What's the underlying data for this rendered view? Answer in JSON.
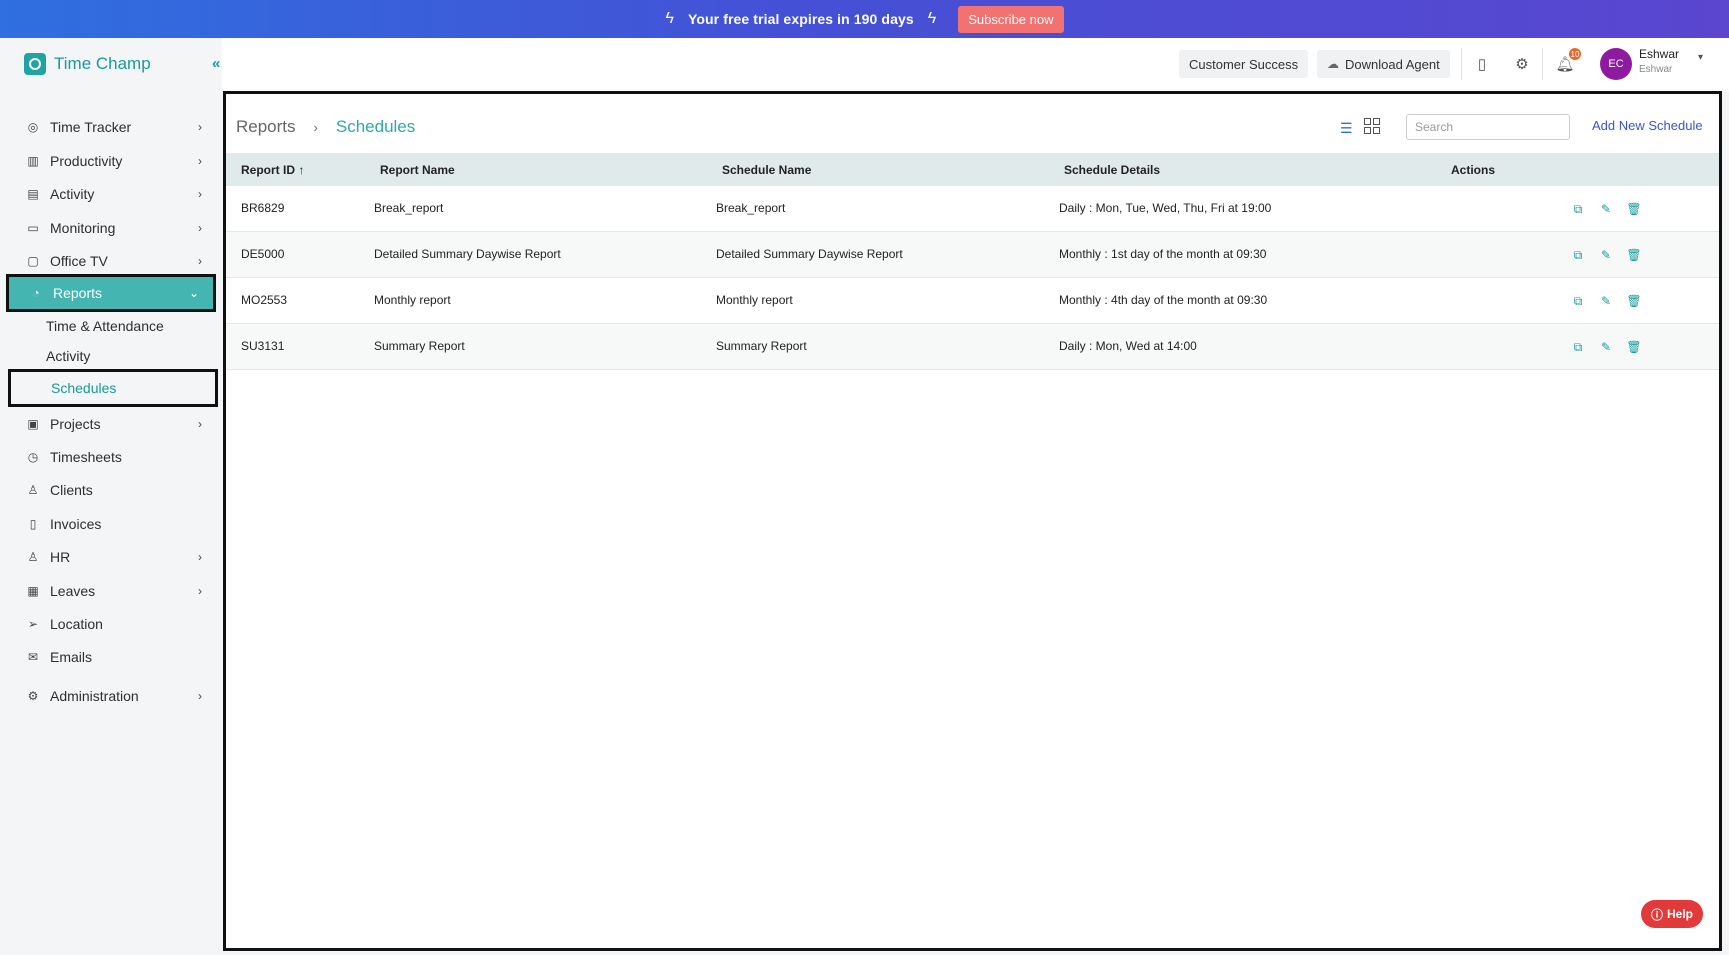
{
  "banner": {
    "text": "Your free trial expires in 190 days",
    "subscribe_label": "Subscribe now"
  },
  "brand": {
    "name": "Time Champ",
    "collapse_glyph": "«"
  },
  "sidebar": {
    "items": [
      {
        "label": "Time Tracker",
        "icon": "target-icon"
      },
      {
        "label": "Productivity",
        "icon": "bar-chart-icon"
      },
      {
        "label": "Activity",
        "icon": "activity-icon"
      },
      {
        "label": "Monitoring",
        "icon": "monitor-icon"
      },
      {
        "label": "Office TV",
        "icon": "tv-icon"
      },
      {
        "label": "Reports",
        "icon": "pie-chart-icon"
      },
      {
        "label": "Projects",
        "icon": "briefcase-icon"
      },
      {
        "label": "Timesheets",
        "icon": "alarm-clock-icon"
      },
      {
        "label": "Clients",
        "icon": "user-badge-icon"
      },
      {
        "label": "Invoices",
        "icon": "invoice-icon"
      },
      {
        "label": "HR",
        "icon": "person-icon"
      },
      {
        "label": "Leaves",
        "icon": "calendar-icon"
      },
      {
        "label": "Location",
        "icon": "navigation-icon"
      },
      {
        "label": "Emails",
        "icon": "mail-icon"
      },
      {
        "label": "Administration",
        "icon": "gear-icon"
      }
    ],
    "reports_sub": [
      {
        "label": "Time & Attendance"
      },
      {
        "label": "Activity"
      },
      {
        "label": "Schedules"
      }
    ]
  },
  "topbar": {
    "customer_success": "Customer Success",
    "download_agent": "Download Agent",
    "notification_count": "10",
    "user": {
      "initials": "EC",
      "name": "Eshwar",
      "sub": "Eshwar"
    }
  },
  "page": {
    "breadcrumb_root": "Reports",
    "breadcrumb_current": "Schedules",
    "search_placeholder": "Search",
    "add_label": "Add New Schedule"
  },
  "table": {
    "columns": [
      "Report ID",
      "Report Name",
      "Schedule Name",
      "Schedule Details",
      "Actions"
    ],
    "sort_indicator": "↑",
    "rows": [
      {
        "id": "BR6829",
        "report_name": "Break_report",
        "schedule_name": "Break_report",
        "details": "Daily : Mon, Tue, Wed, Thu, Fri at 19:00"
      },
      {
        "id": "DE5000",
        "report_name": "Detailed Summary Daywise Report",
        "schedule_name": "Detailed Summary Daywise Report",
        "details": "Monthly : 1st day of the month at 09:30"
      },
      {
        "id": "MO2553",
        "report_name": "Monthly report",
        "schedule_name": "Monthly report",
        "details": "Monthly : 4th day of the month at 09:30"
      },
      {
        "id": "SU3131",
        "report_name": "Summary Report",
        "schedule_name": "Summary Report",
        "details": "Daily : Mon, Wed at 14:00"
      }
    ]
  },
  "help": {
    "label": "Help"
  },
  "colors": {
    "accent": "#1a9a9a",
    "active_nav": "#44b5b1",
    "subscribe": "#f27272",
    "avatar": "#8e1aa0",
    "help": "#e23a3a"
  }
}
